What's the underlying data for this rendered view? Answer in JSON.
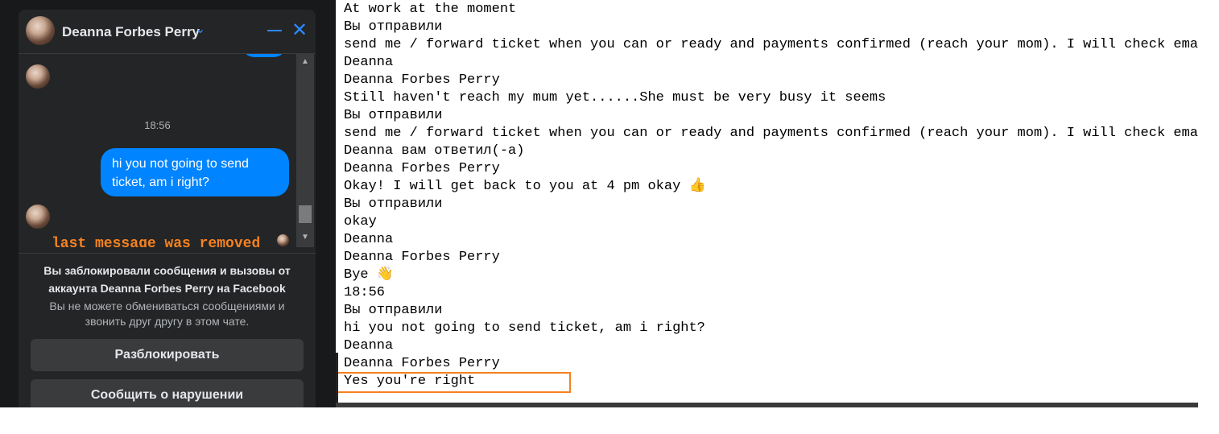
{
  "messenger": {
    "contact_name": "Deanna Forbes Perry",
    "chevron_icon": "chevron-down-icon",
    "minimize_icon": "minimize-icon",
    "close_icon": "close-icon",
    "close_glyph": "✕",
    "time_label": "18:56",
    "sent_message": "hi you not going to send ticket, am i right?",
    "removed_note": "last message was removed",
    "scroll_up_glyph": "▲",
    "scroll_down_glyph": "▼",
    "blocked_title": "Вы заблокировали сообщения и вызовы от аккаунта Deanna Forbes Perry на Facebook",
    "blocked_subtitle": "Вы не можете обмениваться сообщениями и звонить друг другу в этом чате.",
    "unblock_label": "Разблокировать",
    "report_label": "Сообщить о нарушении",
    "accent_color": "#2d88ff",
    "bubble_color": "#0084ff",
    "note_color": "#f58220"
  },
  "log": {
    "lines": [
      "At work at the moment",
      "Вы отправили",
      "send me / forward ticket when you can or ready and payments confirmed (reach your mom). I will check email",
      "Deanna",
      "Deanna Forbes Perry",
      "Still haven't reach my mum yet......She must be very busy it seems",
      "Вы отправили",
      "send me / forward ticket when you can or ready and payments confirmed (reach your mom). I will check email",
      "Deanna вам ответил(-а)",
      "Deanna Forbes Perry",
      "Okay! I will get back to you at 4 pm okay 👍",
      "Вы отправили",
      "okay",
      "Deanna",
      "Deanna Forbes Perry",
      "Bye 👋",
      "18:56",
      "Вы отправили",
      "hi you not going to send ticket, am i right?",
      "Deanna",
      "Deanna Forbes Perry",
      "Yes you're right"
    ],
    "highlight_color": "#f58220"
  }
}
